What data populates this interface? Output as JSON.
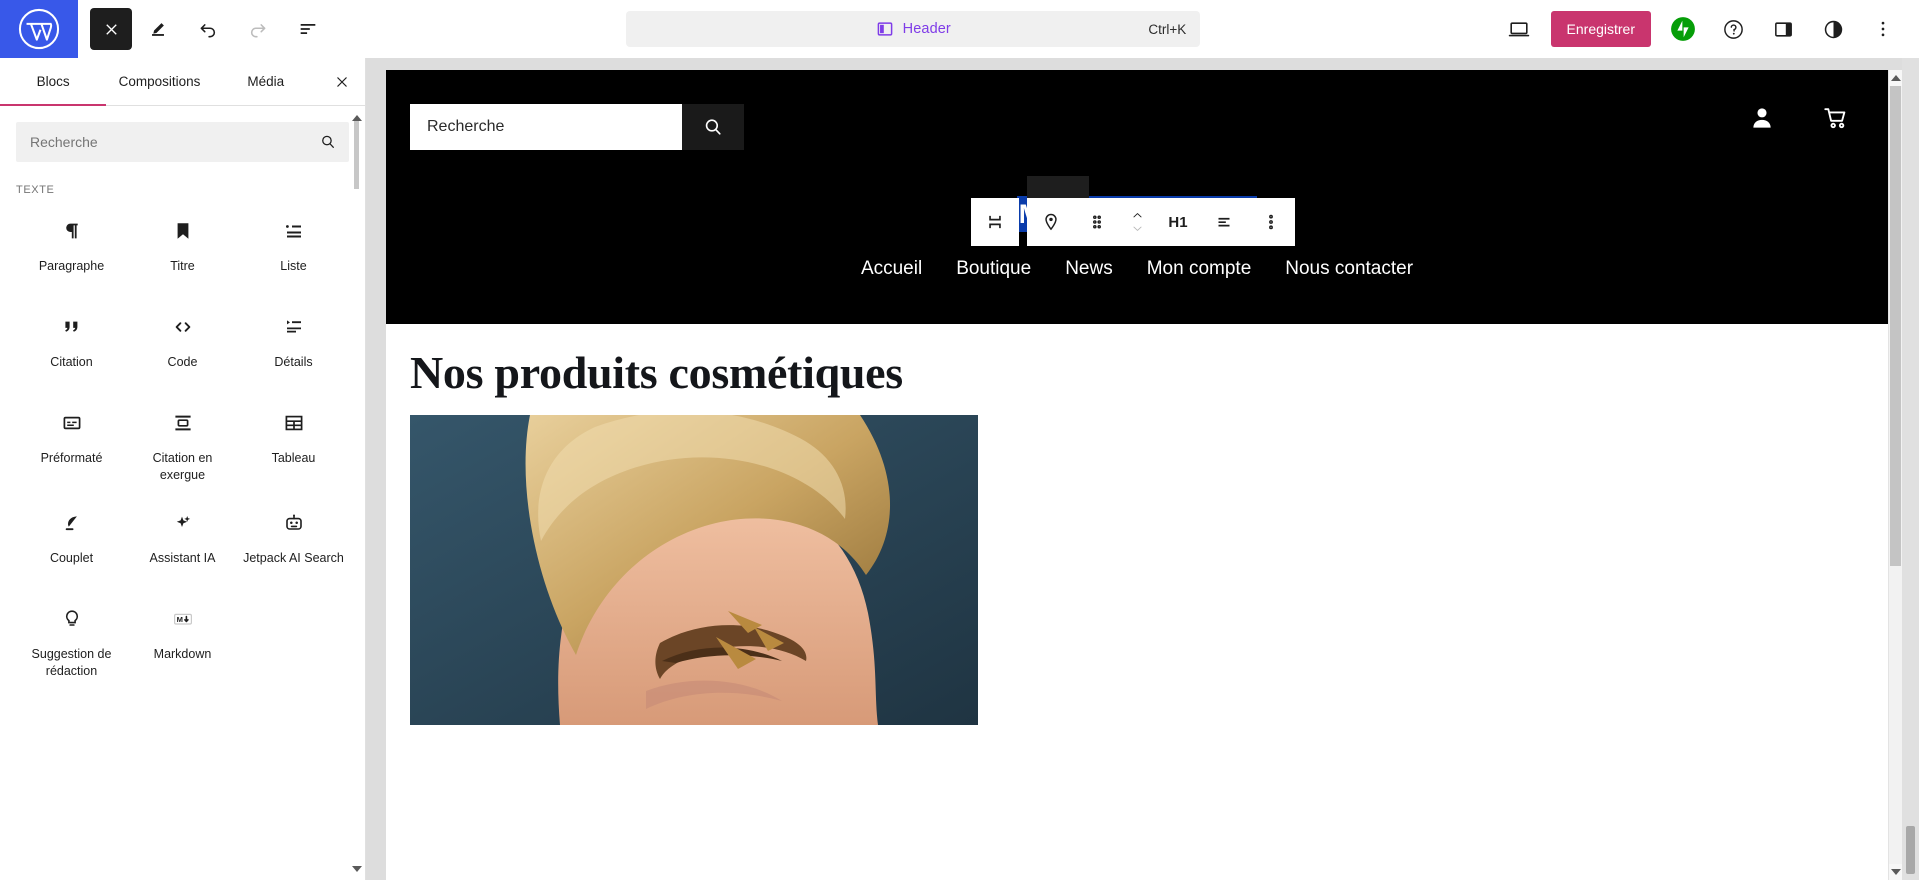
{
  "topbar": {
    "logo_icon": "wordpress-logo-icon",
    "close_icon": "close-icon",
    "edit_icon": "pencil-edit-icon",
    "undo_icon": "undo-icon",
    "redo_icon": "redo-icon",
    "list_view_icon": "list-view-icon",
    "command_bar": {
      "icon": "template-header-icon",
      "label": "Header",
      "shortcut": "Ctrl+K"
    },
    "view_icon": "desktop-preview-icon",
    "save_label": "Enregistrer",
    "jetpack_icon": "jetpack-icon",
    "help_icon": "help-icon",
    "sidebar_icon": "settings-sidebar-icon",
    "styles_icon": "styles-contrast-icon",
    "options_icon": "more-options-icon",
    "accent_pink": "#c9356e",
    "accent_purple": "#7f3ce8",
    "logo_blue": "#3858e9",
    "jetpack_green": "#069e08"
  },
  "inserter": {
    "tabs": [
      {
        "label": "Blocs",
        "active": true
      },
      {
        "label": "Compositions",
        "active": false
      },
      {
        "label": "Média",
        "active": false
      }
    ],
    "close_icon": "close-icon",
    "search": {
      "placeholder": "Recherche",
      "value": "",
      "icon": "search-icon"
    },
    "category": "TEXTE",
    "blocks": [
      {
        "label": "Paragraphe",
        "icon": "paragraph-icon"
      },
      {
        "label": "Titre",
        "icon": "heading-bookmark-icon"
      },
      {
        "label": "Liste",
        "icon": "list-icon"
      },
      {
        "label": "Citation",
        "icon": "quote-icon"
      },
      {
        "label": "Code",
        "icon": "code-icon"
      },
      {
        "label": "Détails",
        "icon": "details-icon"
      },
      {
        "label": "Préformaté",
        "icon": "preformatted-icon"
      },
      {
        "label": "Citation en exergue",
        "icon": "pullquote-icon"
      },
      {
        "label": "Tableau",
        "icon": "table-icon"
      },
      {
        "label": "Couplet",
        "icon": "verse-feather-icon"
      },
      {
        "label": "Assistant IA",
        "icon": "ai-sparkles-icon"
      },
      {
        "label": "Jetpack AI Search",
        "icon": "robot-icon"
      },
      {
        "label": "Suggestion de rédaction",
        "icon": "lightbulb-icon"
      },
      {
        "label": "Markdown",
        "icon": "markdown-icon"
      }
    ]
  },
  "block_toolbar": {
    "parent_icon": "select-parent-block-icon",
    "block_icon": "site-title-pin-icon",
    "drag_icon": "drag-handle-icon",
    "move_up_icon": "move-up-icon",
    "move_down_icon": "move-down-icon",
    "heading_level": "H1",
    "align_icon": "align-text-icon",
    "options_icon": "more-options-icon"
  },
  "canvas": {
    "site_header": {
      "search": {
        "value": "Recherche",
        "submit_icon": "search-icon"
      },
      "account_icon": "account-person-icon",
      "cart_icon": "shopping-cart-icon",
      "site_title": "Ma super boutique",
      "site_title_selected": true,
      "selection_color": "#0a3cab",
      "background": "#000000",
      "nav": [
        "Accueil",
        "Boutique",
        "News",
        "Mon compte",
        "Nous contacter"
      ]
    },
    "content": {
      "heading": "Nos produits cosmétiques",
      "image_alt": "photo-cosmetique-modele"
    }
  },
  "scrollbars": {
    "inserter_up_icon": "scroll-up-arrow",
    "inserter_down_icon": "scroll-down-arrow",
    "canvas_up_icon": "scroll-up-arrow",
    "canvas_down_icon": "scroll-down-arrow"
  }
}
